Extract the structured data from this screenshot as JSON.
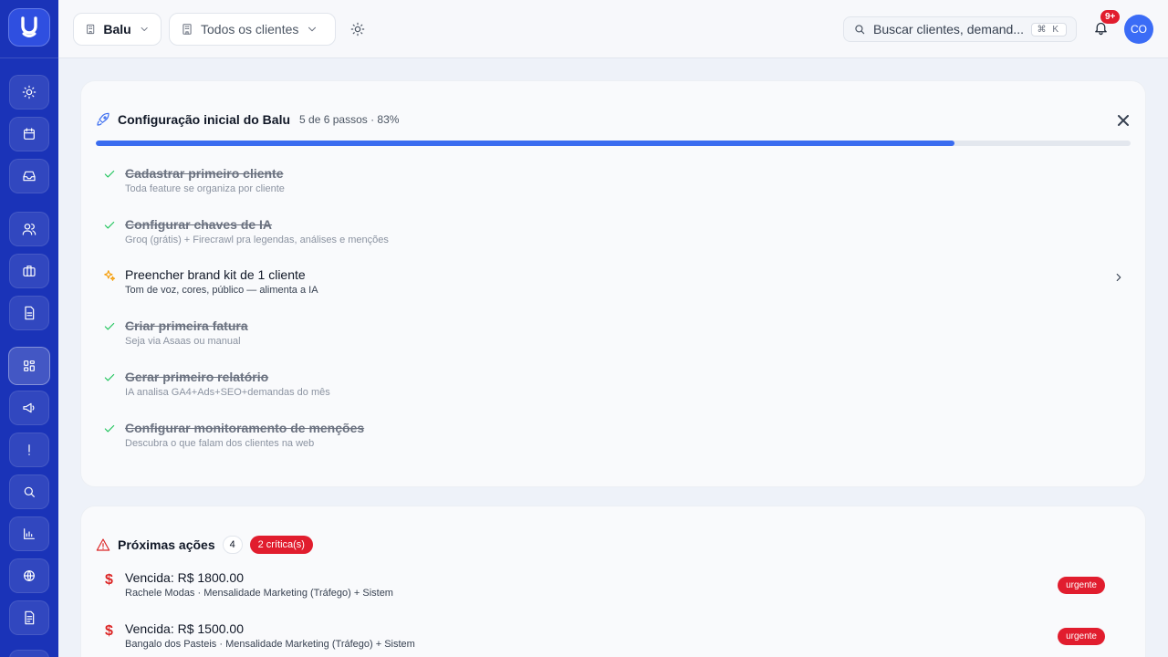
{
  "colors": {
    "sidebar": "#1a33b8",
    "accent": "#3a6cf0",
    "danger": "#e11d2e",
    "success": "#22c55e",
    "warning": "#f59e0b"
  },
  "sidebar": {
    "logo_icon": "u-logo-icon",
    "items": [
      {
        "icon": "sun-icon"
      },
      {
        "icon": "calendar-icon"
      },
      {
        "icon": "inbox-icon"
      },
      {
        "icon": "users-icon"
      },
      {
        "icon": "briefcase-icon"
      },
      {
        "icon": "file-icon"
      },
      {
        "icon": "dashboard-icon",
        "active": true
      },
      {
        "icon": "megaphone-icon"
      },
      {
        "icon": "alert-icon"
      },
      {
        "icon": "search-icon"
      },
      {
        "icon": "chart-icon"
      },
      {
        "icon": "globe-icon"
      },
      {
        "icon": "document-icon"
      }
    ]
  },
  "header": {
    "workspace": "Balu",
    "client_filter": "Todos os clientes",
    "search_placeholder": "Buscar clientes, demand...",
    "search_shortcut": "⌘ K",
    "notifications": "9+",
    "avatar": "CO"
  },
  "onboarding": {
    "title": "Configuração inicial do Balu",
    "meta": "5 de 6 passos · 83%",
    "progress": 0.83,
    "steps": [
      {
        "title": "Cadastrar primeiro cliente",
        "desc": "Toda feature se organiza por cliente",
        "done": true
      },
      {
        "title": "Configurar chaves de IA",
        "desc": "Groq (grátis) + Firecrawl pra legendas, análises e menções",
        "done": true
      },
      {
        "title": "Preencher brand kit de 1 cliente",
        "desc": "Tom de voz, cores, público — alimenta a IA",
        "done": false
      },
      {
        "title": "Criar primeira fatura",
        "desc": "Seja via Asaas ou manual",
        "done": true
      },
      {
        "title": "Gerar primeiro relatório",
        "desc": "IA analisa GA4+Ads+SEO+demandas do mês",
        "done": true
      },
      {
        "title": "Configurar monitoramento de menções",
        "desc": "Descubra o que falam dos clientes na web",
        "done": true
      }
    ]
  },
  "next_actions": {
    "title": "Próximas ações",
    "count": "4",
    "critical": "2 crítica(s)",
    "items": [
      {
        "title": "Vencida: R$ 1800.00",
        "desc": "Rachele Modas · Mensalidade Marketing (Tráfego) + Sistem",
        "tag": "urgente",
        "icon": "dollar-icon"
      },
      {
        "title": "Vencida: R$ 1500.00",
        "desc": "Bangalo dos Pasteis · Mensalidade Marketing (Tráfego) + Sistem",
        "tag": "urgente",
        "icon": "dollar-icon"
      }
    ]
  }
}
